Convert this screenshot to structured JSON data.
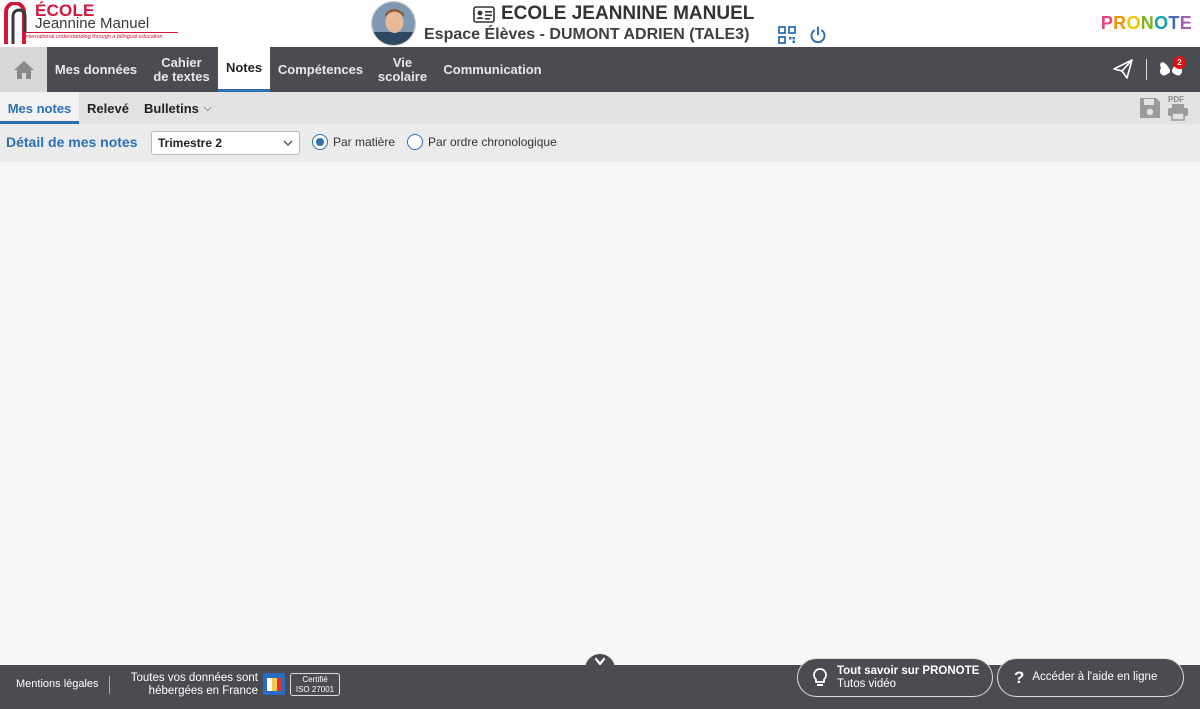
{
  "header": {
    "logo": {
      "title": "ÉCOLE",
      "subtitle": "Jeannine Manuel",
      "tagline": "International understanding through a bilingual education"
    },
    "school_name": "ECOLE JEANNINE MANUEL",
    "space_label": "Espace Élèves - DUMONT ADRIEN (TALE3)",
    "brand": {
      "letters": [
        "P",
        "R",
        "O",
        "N",
        "O",
        "T",
        "E"
      ],
      "colors": [
        "#e8447a",
        "#f39200",
        "#f5c400",
        "#7ab51d",
        "#0fa3b1",
        "#3e6fb5",
        "#a45eb1"
      ]
    }
  },
  "nav": {
    "items": [
      {
        "label_line1": "Mes données",
        "label_line2": ""
      },
      {
        "label_line1": "Cahier",
        "label_line2": "de textes"
      },
      {
        "label_line1": "Notes",
        "label_line2": ""
      },
      {
        "label_line1": "Compétences",
        "label_line2": ""
      },
      {
        "label_line1": "Vie",
        "label_line2": "scolaire"
      },
      {
        "label_line1": "Communication",
        "label_line2": ""
      }
    ],
    "notifications_count": "2"
  },
  "subnav": {
    "items": [
      {
        "label": "Mes notes"
      },
      {
        "label": "Relevé"
      },
      {
        "label": "Bulletins"
      }
    ],
    "pdf_label": "PDF"
  },
  "filter": {
    "label": "Détail de mes notes",
    "period": "Trimestre 2",
    "radio_by_subject": "Par matière",
    "radio_chronological": "Par ordre chronologique"
  },
  "footer": {
    "legal": "Mentions légales",
    "data_line1": "Toutes vos données sont",
    "data_line2": "hébergées en France",
    "cert_line1": "Certifié",
    "cert_line2": "ISO 27001",
    "tutos_title": "Tout savoir sur PRONOTE",
    "tutos_sub": "Tutos vidéo",
    "help": "Accéder à l'aide en ligne"
  },
  "colors": {
    "accent": "#2f6fb4",
    "nav_bg": "#4b4c52",
    "brand_red": "#d3163a"
  }
}
